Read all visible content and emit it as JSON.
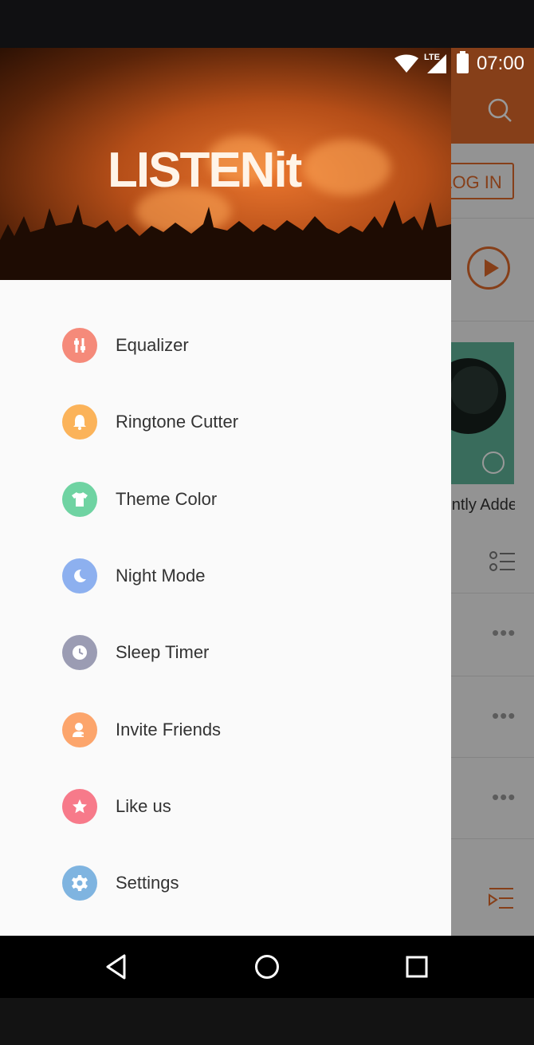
{
  "status_bar": {
    "time": "07:00",
    "network": "LTE"
  },
  "drawer": {
    "logo": "LISTENit",
    "menu": [
      {
        "label": "Equalizer",
        "icon": "equalizer-icon",
        "color": "#f58a7a"
      },
      {
        "label": "Ringtone Cutter",
        "icon": "bell-icon",
        "color": "#fbb35a"
      },
      {
        "label": "Theme Color",
        "icon": "shirt-icon",
        "color": "#6fd3a2"
      },
      {
        "label": "Night Mode",
        "icon": "moon-icon",
        "color": "#8db0ef"
      },
      {
        "label": "Sleep Timer",
        "icon": "clock-icon",
        "color": "#9b9cb3"
      },
      {
        "label": "Invite Friends",
        "icon": "add-person-icon",
        "color": "#fca56c"
      },
      {
        "label": "Like us",
        "icon": "star-icon",
        "color": "#f77a8a"
      },
      {
        "label": "Settings",
        "icon": "gear-icon",
        "color": "#7fb4e0"
      }
    ]
  },
  "background_app": {
    "login_button": "LOG IN",
    "album_label": "Recently Added",
    "accent_color": "#e0692b"
  }
}
